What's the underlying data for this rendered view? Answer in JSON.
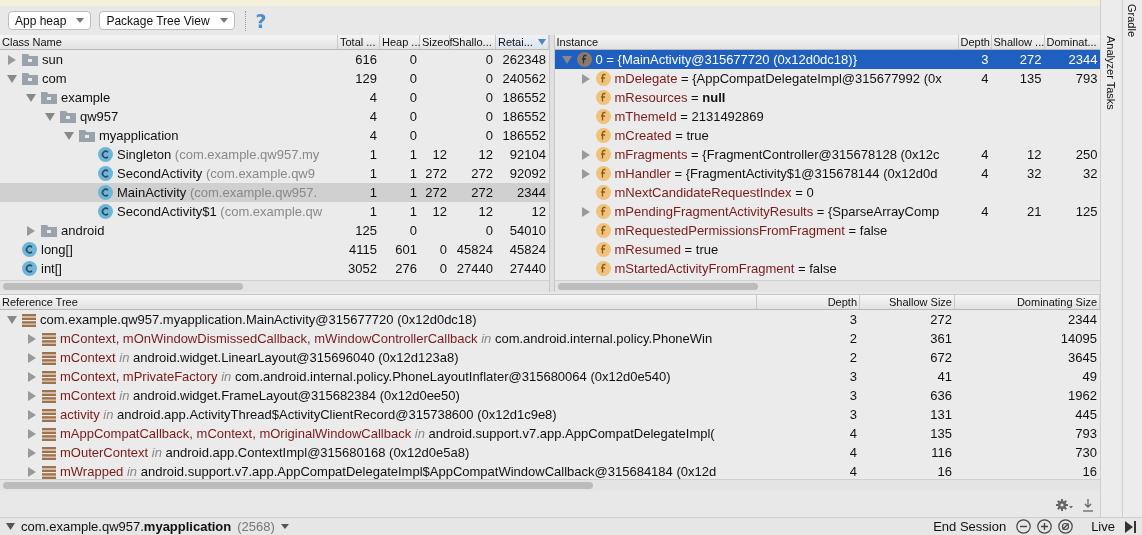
{
  "toolbar": {
    "heap_dropdown": "App heap",
    "view_dropdown": "Package Tree View",
    "help": "?"
  },
  "class_table": {
    "tree_column": "Class Name",
    "columns": [
      {
        "label": "Total ...",
        "sorted": false
      },
      {
        "label": "Heap ...",
        "sorted": false
      },
      {
        "label": "Sizeof",
        "sorted": false
      },
      {
        "label": "Shallo...",
        "sorted": false
      },
      {
        "label": "Retai...",
        "sorted": true
      }
    ],
    "rows": [
      {
        "kind": "folder",
        "name": "sun",
        "expanded": false,
        "selected": false,
        "cells": [
          "616",
          "0",
          "",
          "0",
          "262348"
        ]
      },
      {
        "kind": "folder",
        "name": "com",
        "expanded": true,
        "selected": false,
        "cells": [
          "129",
          "0",
          "",
          "0",
          "240562"
        ],
        "children": [
          {
            "kind": "folder",
            "name": "example",
            "expanded": true,
            "selected": false,
            "cells": [
              "4",
              "0",
              "",
              "0",
              "186552"
            ],
            "children": [
              {
                "kind": "folder",
                "name": "qw957",
                "expanded": true,
                "selected": false,
                "cells": [
                  "4",
                  "0",
                  "",
                  "0",
                  "186552"
                ],
                "children": [
                  {
                    "kind": "folder",
                    "name": "myapplication",
                    "expanded": true,
                    "selected": false,
                    "cells": [
                      "4",
                      "0",
                      "",
                      "0",
                      "186552"
                    ],
                    "children": [
                      {
                        "kind": "class",
                        "name": "Singleton",
                        "package": "(com.example.qw957.my",
                        "selected": false,
                        "cells": [
                          "1",
                          "1",
                          "12",
                          "12",
                          "92104"
                        ]
                      },
                      {
                        "kind": "class",
                        "name": "SecondActivity",
                        "package": "(com.example.qw9",
                        "selected": false,
                        "cells": [
                          "1",
                          "1",
                          "272",
                          "272",
                          "92092"
                        ]
                      },
                      {
                        "kind": "class",
                        "name": "MainActivity",
                        "package": "(com.example.qw957.",
                        "selected": true,
                        "cells": [
                          "1",
                          "1",
                          "272",
                          "272",
                          "2344"
                        ]
                      },
                      {
                        "kind": "class",
                        "name": "SecondActivity$1",
                        "package": "(com.example.qw",
                        "selected": false,
                        "cells": [
                          "1",
                          "1",
                          "12",
                          "12",
                          "12"
                        ]
                      }
                    ]
                  }
                ]
              }
            ]
          },
          {
            "kind": "folder",
            "name": "android",
            "expanded": false,
            "selected": false,
            "cells": [
              "125",
              "0",
              "",
              "0",
              "54010"
            ]
          }
        ]
      },
      {
        "kind": "class",
        "name": "long[]",
        "selected": false,
        "cells": [
          "4115",
          "601",
          "0",
          "45824",
          "45824"
        ]
      },
      {
        "kind": "class",
        "name": "int[]",
        "selected": false,
        "cells": [
          "3052",
          "276",
          "0",
          "27440",
          "27440"
        ]
      }
    ]
  },
  "instance_table": {
    "tree_column": "Instance",
    "columns": [
      {
        "label": "Depth",
        "sorted": false
      },
      {
        "label": "Shallow ...",
        "sorted": false
      },
      {
        "label": "Dominat...",
        "sorted": false
      }
    ],
    "rows": [
      {
        "field": "0",
        "value": "= {MainActivity@315677720 (0x12d0dc18)}",
        "expanded": true,
        "selected": true,
        "cells": [
          "3",
          "272",
          "2344"
        ],
        "children": [
          {
            "field": "mDelegate",
            "value": "= {AppCompatDelegateImpl@315677992 (0x",
            "expanded": false,
            "selected": false,
            "cells": [
              "4",
              "135",
              "793"
            ]
          },
          {
            "field": "mResources",
            "value": "= **null**",
            "selected": false
          },
          {
            "field": "mThemeId",
            "value": "= 2131492869",
            "selected": false
          },
          {
            "field": "mCreated",
            "value": "= true",
            "selected": false
          },
          {
            "field": "mFragments",
            "value": "= {FragmentController@315678128 (0x12c",
            "expanded": false,
            "selected": false,
            "cells": [
              "4",
              "12",
              "250"
            ]
          },
          {
            "field": "mHandler",
            "value": "= {FragmentActivity$1@315678144 (0x12d0d",
            "expanded": false,
            "selected": false,
            "cells": [
              "4",
              "32",
              "32"
            ]
          },
          {
            "field": "mNextCandidateRequestIndex",
            "value": "= 0",
            "selected": false
          },
          {
            "field": "mPendingFragmentActivityResults",
            "value": "= {SparseArrayComp",
            "expanded": false,
            "selected": false,
            "cells": [
              "4",
              "21",
              "125"
            ]
          },
          {
            "field": "mRequestedPermissionsFromFragment",
            "value": "= false",
            "selected": false
          },
          {
            "field": "mResumed",
            "value": "= true",
            "selected": false
          },
          {
            "field": "mStartedActivityFromFragment",
            "value": "= false",
            "selected": false
          }
        ]
      }
    ]
  },
  "reference_tree": {
    "tree_column": "Reference Tree",
    "columns": [
      {
        "label": "Depth",
        "sorted": false
      },
      {
        "label": "Shallow Size",
        "sorted": false
      },
      {
        "label": "Dominating Size",
        "sorted": false
      }
    ],
    "rows": [
      {
        "target": "com.example.qw957.myapplication.MainActivity@315677720 (0x12d0dc18)",
        "expanded": true,
        "selected": false,
        "cells": [
          "3",
          "272",
          "2344"
        ],
        "children": [
          {
            "refs": "mContext, mOnWindowDismissedCallback, mWindowControllerCallback",
            "connector": "in",
            "target": "com.android.internal.policy.PhoneWin",
            "expanded": false,
            "selected": false,
            "cells": [
              "2",
              "361",
              "14095"
            ]
          },
          {
            "refs": "mContext",
            "connector": "in",
            "target": "android.widget.LinearLayout@315696040 (0x12d123a8)",
            "expanded": false,
            "selected": false,
            "cells": [
              "2",
              "672",
              "3645"
            ]
          },
          {
            "refs": "mContext, mPrivateFactory",
            "connector": "in",
            "target": "com.android.internal.policy.PhoneLayoutInflater@315680064 (0x12d0e540)",
            "expanded": false,
            "selected": false,
            "cells": [
              "3",
              "41",
              "49"
            ]
          },
          {
            "refs": "mContext",
            "connector": "in",
            "target": "android.widget.FrameLayout@315682384 (0x12d0ee50)",
            "expanded": false,
            "selected": false,
            "cells": [
              "3",
              "636",
              "1962"
            ]
          },
          {
            "refs": "activity",
            "connector": "in",
            "target": "android.app.ActivityThread$ActivityClientRecord@315738600 (0x12d1c9e8)",
            "expanded": false,
            "selected": false,
            "cells": [
              "3",
              "131",
              "445"
            ]
          },
          {
            "refs": "mAppCompatCallback, mContext, mOriginalWindowCallback",
            "connector": "in",
            "target": "android.support.v7.app.AppCompatDelegateImpl(",
            "expanded": false,
            "selected": false,
            "cells": [
              "4",
              "135",
              "793"
            ]
          },
          {
            "refs": "mOuterContext",
            "connector": "in",
            "target": "android.app.ContextImpl@315680168 (0x12d0e5a8)",
            "expanded": false,
            "selected": false,
            "cells": [
              "4",
              "116",
              "730"
            ]
          },
          {
            "refs": "mWrapped",
            "connector": "in",
            "target": "android.support.v7.app.AppCompatDelegateImpl$AppCompatWindowCallback@315684184 (0x12d",
            "expanded": false,
            "selected": false,
            "cells": [
              "4",
              "16",
              "16"
            ]
          }
        ]
      }
    ]
  },
  "side_tabs": [
    "Analyzer Tasks"
  ],
  "corner_tab": "Gradle",
  "status_bar": {
    "process": "com.example.qw957.**myapplication**",
    "pid": "(2568)",
    "end_session": "End Session",
    "live": "Live"
  }
}
